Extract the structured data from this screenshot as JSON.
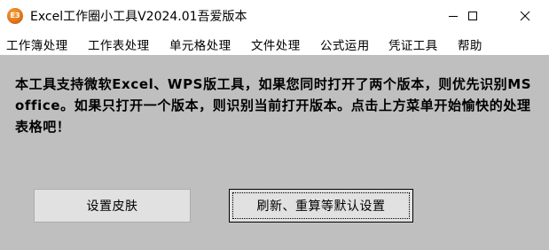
{
  "window": {
    "title": "Excel工作圈小工具V2024.01吾爱版本",
    "icon_label": "E3",
    "controls": [
      "minimize-icon",
      "maximize-icon",
      "close-icon"
    ]
  },
  "menu": [
    {
      "label": "工作簿处理"
    },
    {
      "label": "工作表处理"
    },
    {
      "label": "单元格处理"
    },
    {
      "label": "文件处理"
    },
    {
      "label": "公式运用"
    },
    {
      "label": "凭证工具"
    },
    {
      "label": "帮助"
    }
  ],
  "main": {
    "message": "本工具支持微软Excel、WPS版工具，如果您同时打开了两个版本，则优先识别MS office。如果只打开一个版本，则识别当前打开版本。点击上方菜单开始愉快的处理表格吧！",
    "buttons": {
      "skin": "设置皮肤",
      "reset": "刷新、重算等默认设置"
    }
  },
  "colors": {
    "client_background": "#bfbfbf",
    "button_face": "#e1e1e1",
    "icon_orange": "#e4761b"
  }
}
